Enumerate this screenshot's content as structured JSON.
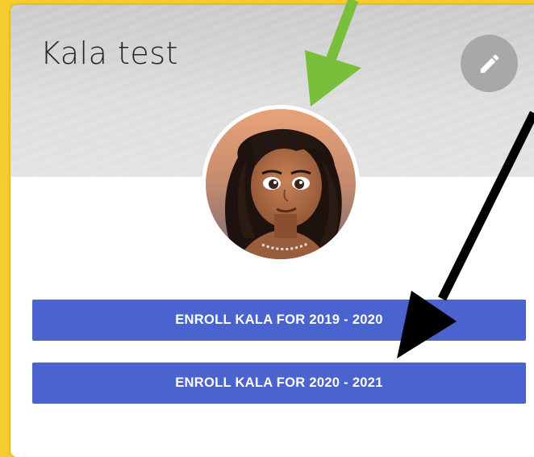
{
  "profile": {
    "name": "Kala test"
  },
  "actions": {
    "enroll_buttons": [
      {
        "label": "ENROLL KALA FOR 2019 - 2020"
      },
      {
        "label": "ENROLL KALA FOR 2020 - 2021"
      }
    ]
  },
  "icons": {
    "edit": "pencil-icon",
    "avatar": "avatar"
  },
  "colors": {
    "page_background": "#f4cc2e",
    "button": "#4a63cf",
    "button_text": "#ffffff",
    "edit_button": "#a8a8a8",
    "annotation_green": "#79bf3c",
    "annotation_black": "#000000"
  }
}
